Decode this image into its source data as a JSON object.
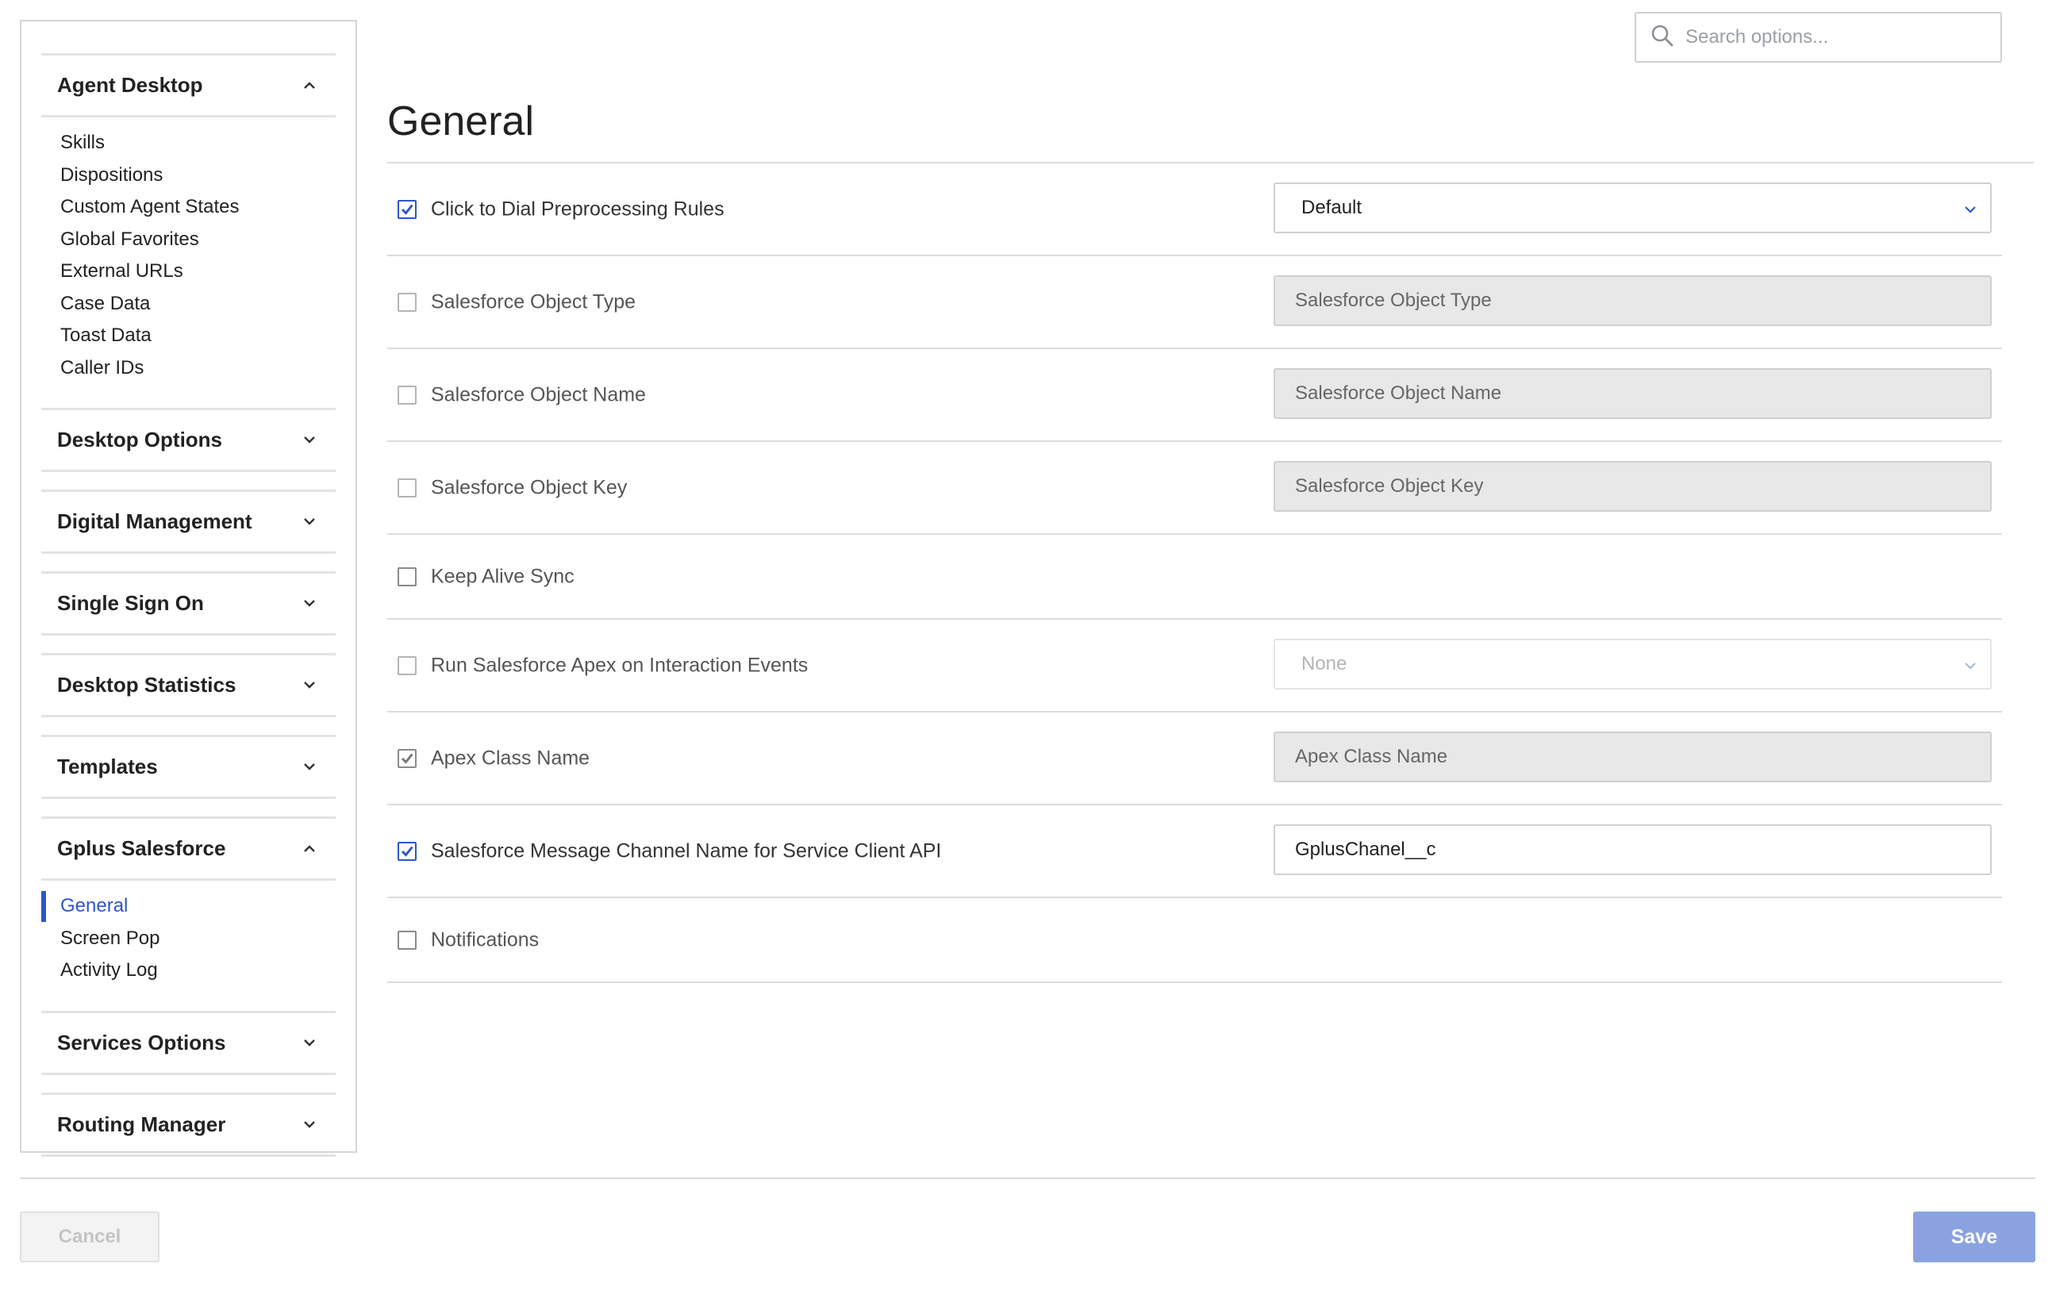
{
  "search": {
    "placeholder": "Search options..."
  },
  "page": {
    "title": "General"
  },
  "sidebar": {
    "sections": [
      {
        "label": "Agent Desktop",
        "expanded": true,
        "items": [
          "Skills",
          "Dispositions",
          "Custom Agent States",
          "Global Favorites",
          "External URLs",
          "Case Data",
          "Toast Data",
          "Caller IDs"
        ]
      },
      {
        "label": "Desktop Options",
        "expanded": false,
        "items": []
      },
      {
        "label": "Digital Management",
        "expanded": false,
        "items": []
      },
      {
        "label": "Single Sign On",
        "expanded": false,
        "items": []
      },
      {
        "label": "Desktop Statistics",
        "expanded": false,
        "items": []
      },
      {
        "label": "Templates",
        "expanded": false,
        "items": []
      },
      {
        "label": "Gplus Salesforce",
        "expanded": true,
        "items": [
          "General",
          "Screen Pop",
          "Activity Log"
        ],
        "active_item": "General"
      },
      {
        "label": "Services Options",
        "expanded": false,
        "items": []
      },
      {
        "label": "Routing Manager",
        "expanded": false,
        "items": []
      }
    ]
  },
  "settings": [
    {
      "label": "Click to Dial Preprocessing Rules",
      "checked": true,
      "control": "select",
      "value": "Default",
      "disabled": false
    },
    {
      "label": "Salesforce Object Type",
      "checked": false,
      "control": "input",
      "value": "Salesforce Object Type",
      "disabled": true
    },
    {
      "label": "Salesforce Object Name",
      "checked": false,
      "control": "input",
      "value": "Salesforce Object Name",
      "disabled": true
    },
    {
      "label": "Salesforce Object Key",
      "checked": false,
      "control": "input",
      "value": "Salesforce Object Key",
      "disabled": true
    },
    {
      "label": "Keep Alive Sync",
      "checked": false,
      "control": "none"
    },
    {
      "label": "Run Salesforce Apex on Interaction Events",
      "checked": false,
      "control": "select",
      "value": "None",
      "disabled": true
    },
    {
      "label": "Apex Class Name",
      "checked": true,
      "control": "input",
      "value": "Apex Class Name",
      "disabled": true
    },
    {
      "label": "Salesforce Message Channel Name for Service Client API",
      "checked": true,
      "control": "input",
      "value": "GplusChanel__c",
      "disabled": false
    },
    {
      "label": "Notifications",
      "checked": false,
      "control": "none"
    }
  ],
  "footer": {
    "cancel_label": "Cancel",
    "save_label": "Save"
  },
  "colors": {
    "accent": "#2e56c9",
    "save_button": "#8aa3e0",
    "disabled_field": "#e8e8e8"
  }
}
